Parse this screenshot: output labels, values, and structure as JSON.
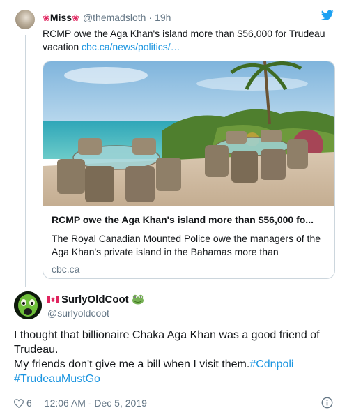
{
  "quoted_tweet": {
    "author_name": "Miss",
    "author_handle": "@themadsloth",
    "separator": "·",
    "time": "19h",
    "text": "RCMP owe the Aga Khan's island more than $56,000 for Trudeau vacation",
    "link": "cbc.ca/news/politics/…",
    "card": {
      "title": "RCMP owe the Aga Khan's island more than $56,000 fo...",
      "description": "The Royal Canadian Mounted Police owe the managers of the Aga Khan's private island in the Bahamas more than",
      "domain": "cbc.ca"
    }
  },
  "tweet": {
    "author_name": "SurlyOldCoot",
    "author_handle": "@surlyoldcoot",
    "text": "I thought that billionaire Chaka Aga Khan was a good friend of Trudeau.",
    "text_line2": "My friends don't give me a bill when I visit them.",
    "hashtag1": "#Cdnpoli",
    "hashtag2": "#TrudeauMustGo",
    "likes": "6",
    "timestamp": "12:06 AM - Dec 5, 2019"
  },
  "icons": {
    "twitter": "twitter-bird-icon",
    "like": "heart-icon",
    "info": "info-icon",
    "flag": "canada-flag-icon",
    "frog": "frog-emoji-icon",
    "maple": "maple-leaf-icon"
  },
  "colors": {
    "link": "#1b95e0",
    "secondary_text": "#657786",
    "border": "#ccd6dd",
    "maple": "#e0245e"
  }
}
